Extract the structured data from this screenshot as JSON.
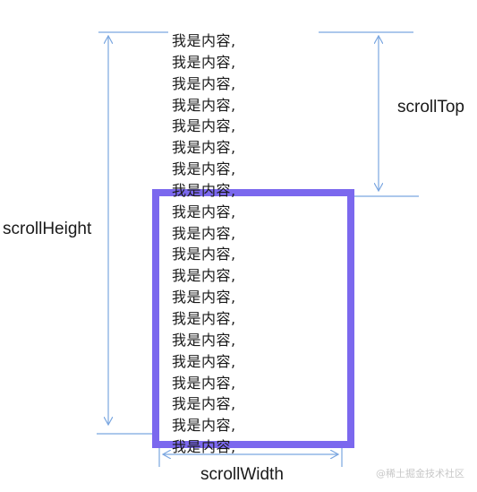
{
  "content": {
    "lines": [
      "我是内容,",
      "我是内容,",
      "我是内容,",
      "我是内容,",
      "我是内容,",
      "我是内容,",
      "我是内容,",
      "我是内容,",
      "我是内容,",
      "我是内容,",
      "我是内容,",
      "我是内容,",
      "我是内容,",
      "我是内容,",
      "我是内容,",
      "我是内容,",
      "我是内容,",
      "我是内容,",
      "我是内容,",
      "我是内容,"
    ]
  },
  "labels": {
    "scroll_height": "scrollHeight",
    "scroll_top": "scrollTop",
    "scroll_width": "scrollWidth"
  },
  "watermark": "@稀土掘金技术社区",
  "colors": {
    "viewport_border": "#7b68ee",
    "guide_lines": "#7aa6e0",
    "text": "#1a1a1a"
  }
}
